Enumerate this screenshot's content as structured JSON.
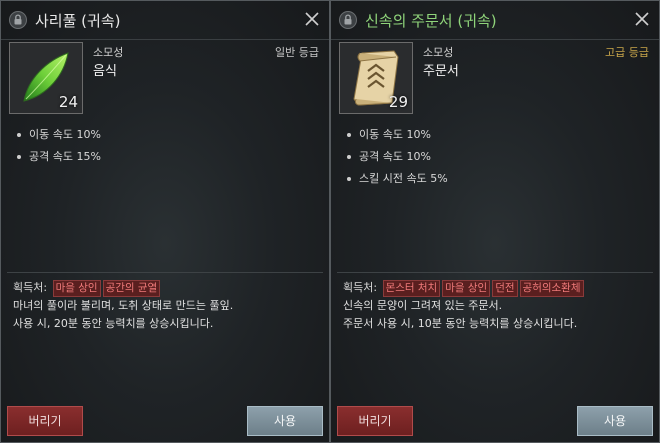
{
  "panels": [
    {
      "title": "사리풀 (귀속)",
      "item_count": "24",
      "item_type": "소모성",
      "item_category": "음식",
      "grade": "일반 등급",
      "stats": [
        "이동 속도 10%",
        "공격 속도 15%"
      ],
      "acquire_label": "획득처:",
      "acquire_tags": [
        "마을 상인",
        "공간의 균열"
      ],
      "description": [
        "마녀의 풀이라 불리며, 도취 상태로 만드는 풀잎.",
        "사용 시, 20분 동안 능력치를 상승시킵니다."
      ],
      "discard_label": "버리기",
      "use_label": "사용",
      "icon": "leaf-icon"
    },
    {
      "title": "신속의 주문서 (귀속)",
      "item_count": "29",
      "item_type": "소모성",
      "item_category": "주문서",
      "grade": "고급 등급",
      "stats": [
        "이동 속도 10%",
        "공격 속도 10%",
        "스킬 시전 속도 5%"
      ],
      "acquire_label": "획득처:",
      "acquire_tags": [
        "몬스터 처치",
        "마을 상인",
        "던전",
        "공허의소환체"
      ],
      "description": [
        "신속의 문양이 그려져 있는 주문서.",
        "주문서 사용 시, 10분 동안 능력치를 상승시킵니다."
      ],
      "discard_label": "버리기",
      "use_label": "사용",
      "icon": "scroll-icon"
    }
  ],
  "colors": {
    "title_rare": "#8fd47a",
    "grade_rare": "#c9a64a",
    "tag_text": "#ef7a7a"
  }
}
